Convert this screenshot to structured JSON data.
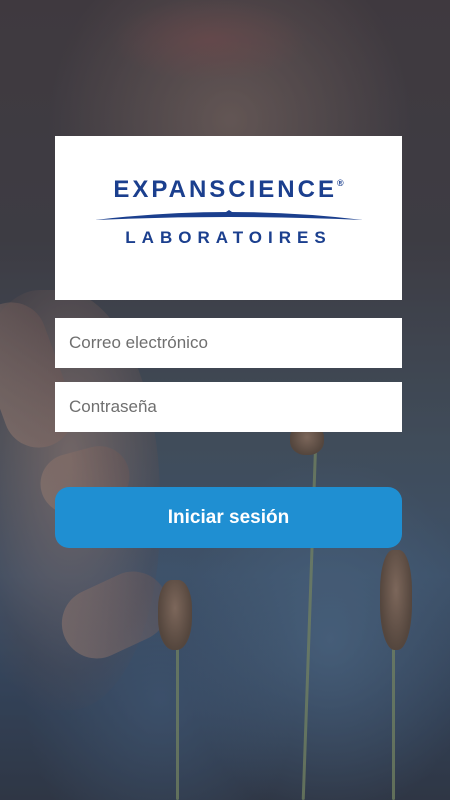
{
  "logo": {
    "brand_name": "EXPANSCIENCE",
    "registered_mark": "®",
    "subtitle": "LABORATOIRES"
  },
  "login_form": {
    "email_placeholder": "Correo electrónico",
    "password_placeholder": "Contraseña",
    "submit_label": "Iniciar sesión"
  },
  "colors": {
    "brand_blue": "#1b3f8e",
    "button_blue": "#1f8fd2",
    "field_background": "#ffffff"
  },
  "background": {
    "icon": "photo-child-with-plants"
  }
}
